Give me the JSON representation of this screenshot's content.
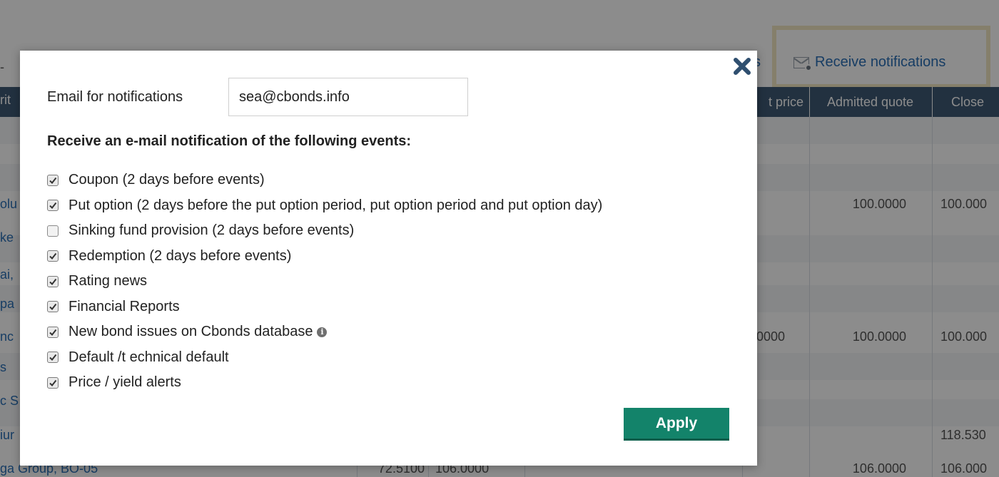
{
  "background": {
    "partial_link_s": "s",
    "receive_notifications": "Receive notifications",
    "left_dash": "-",
    "table_headers": [
      "t price",
      "Admitted quote",
      "Close"
    ],
    "left_fragments": [
      "rit",
      "olu",
      "ke",
      "ai,",
      "pa",
      "nc",
      "s",
      "c S",
      "iur",
      "ga Group, BO-05"
    ],
    "cells": {
      "r1_admitted": "100.0000",
      "r1_close": "100.000",
      "r2_price": "0000",
      "r2_admitted": "100.0000",
      "r2_close": "100.000",
      "r3_close": "118.530",
      "r4_a": "72.5100",
      "r4_b": "106.0000",
      "r4_admitted": "106.0000",
      "r4_close": "106.000"
    }
  },
  "modal": {
    "email_label": "Email for notifications",
    "email_value": "sea@cbonds.info",
    "section_title": "Receive an e-mail notification of the following events:",
    "events": [
      {
        "label": "Coupon (2 days before events)",
        "checked": true
      },
      {
        "label": "Put option (2 days before the put option period, put option period and put option day)",
        "checked": true
      },
      {
        "label": "Sinking fund provision (2 days before events)",
        "checked": false
      },
      {
        "label": "Redemption (2 days before events)",
        "checked": true
      },
      {
        "label": "Rating news",
        "checked": true
      },
      {
        "label": "Financial Reports",
        "checked": true
      },
      {
        "label": "New bond issues on Cbonds database",
        "checked": true,
        "info": true
      },
      {
        "label": "Default /t echnical default",
        "checked": true
      },
      {
        "label": "Price / yield alerts",
        "checked": true
      }
    ],
    "apply_label": "Apply",
    "info_glyph": "i"
  },
  "colors": {
    "accent": "#13836a",
    "header": "#3e5a75",
    "link": "#2a6fb6",
    "highlight_border": "#f3e8c4"
  }
}
